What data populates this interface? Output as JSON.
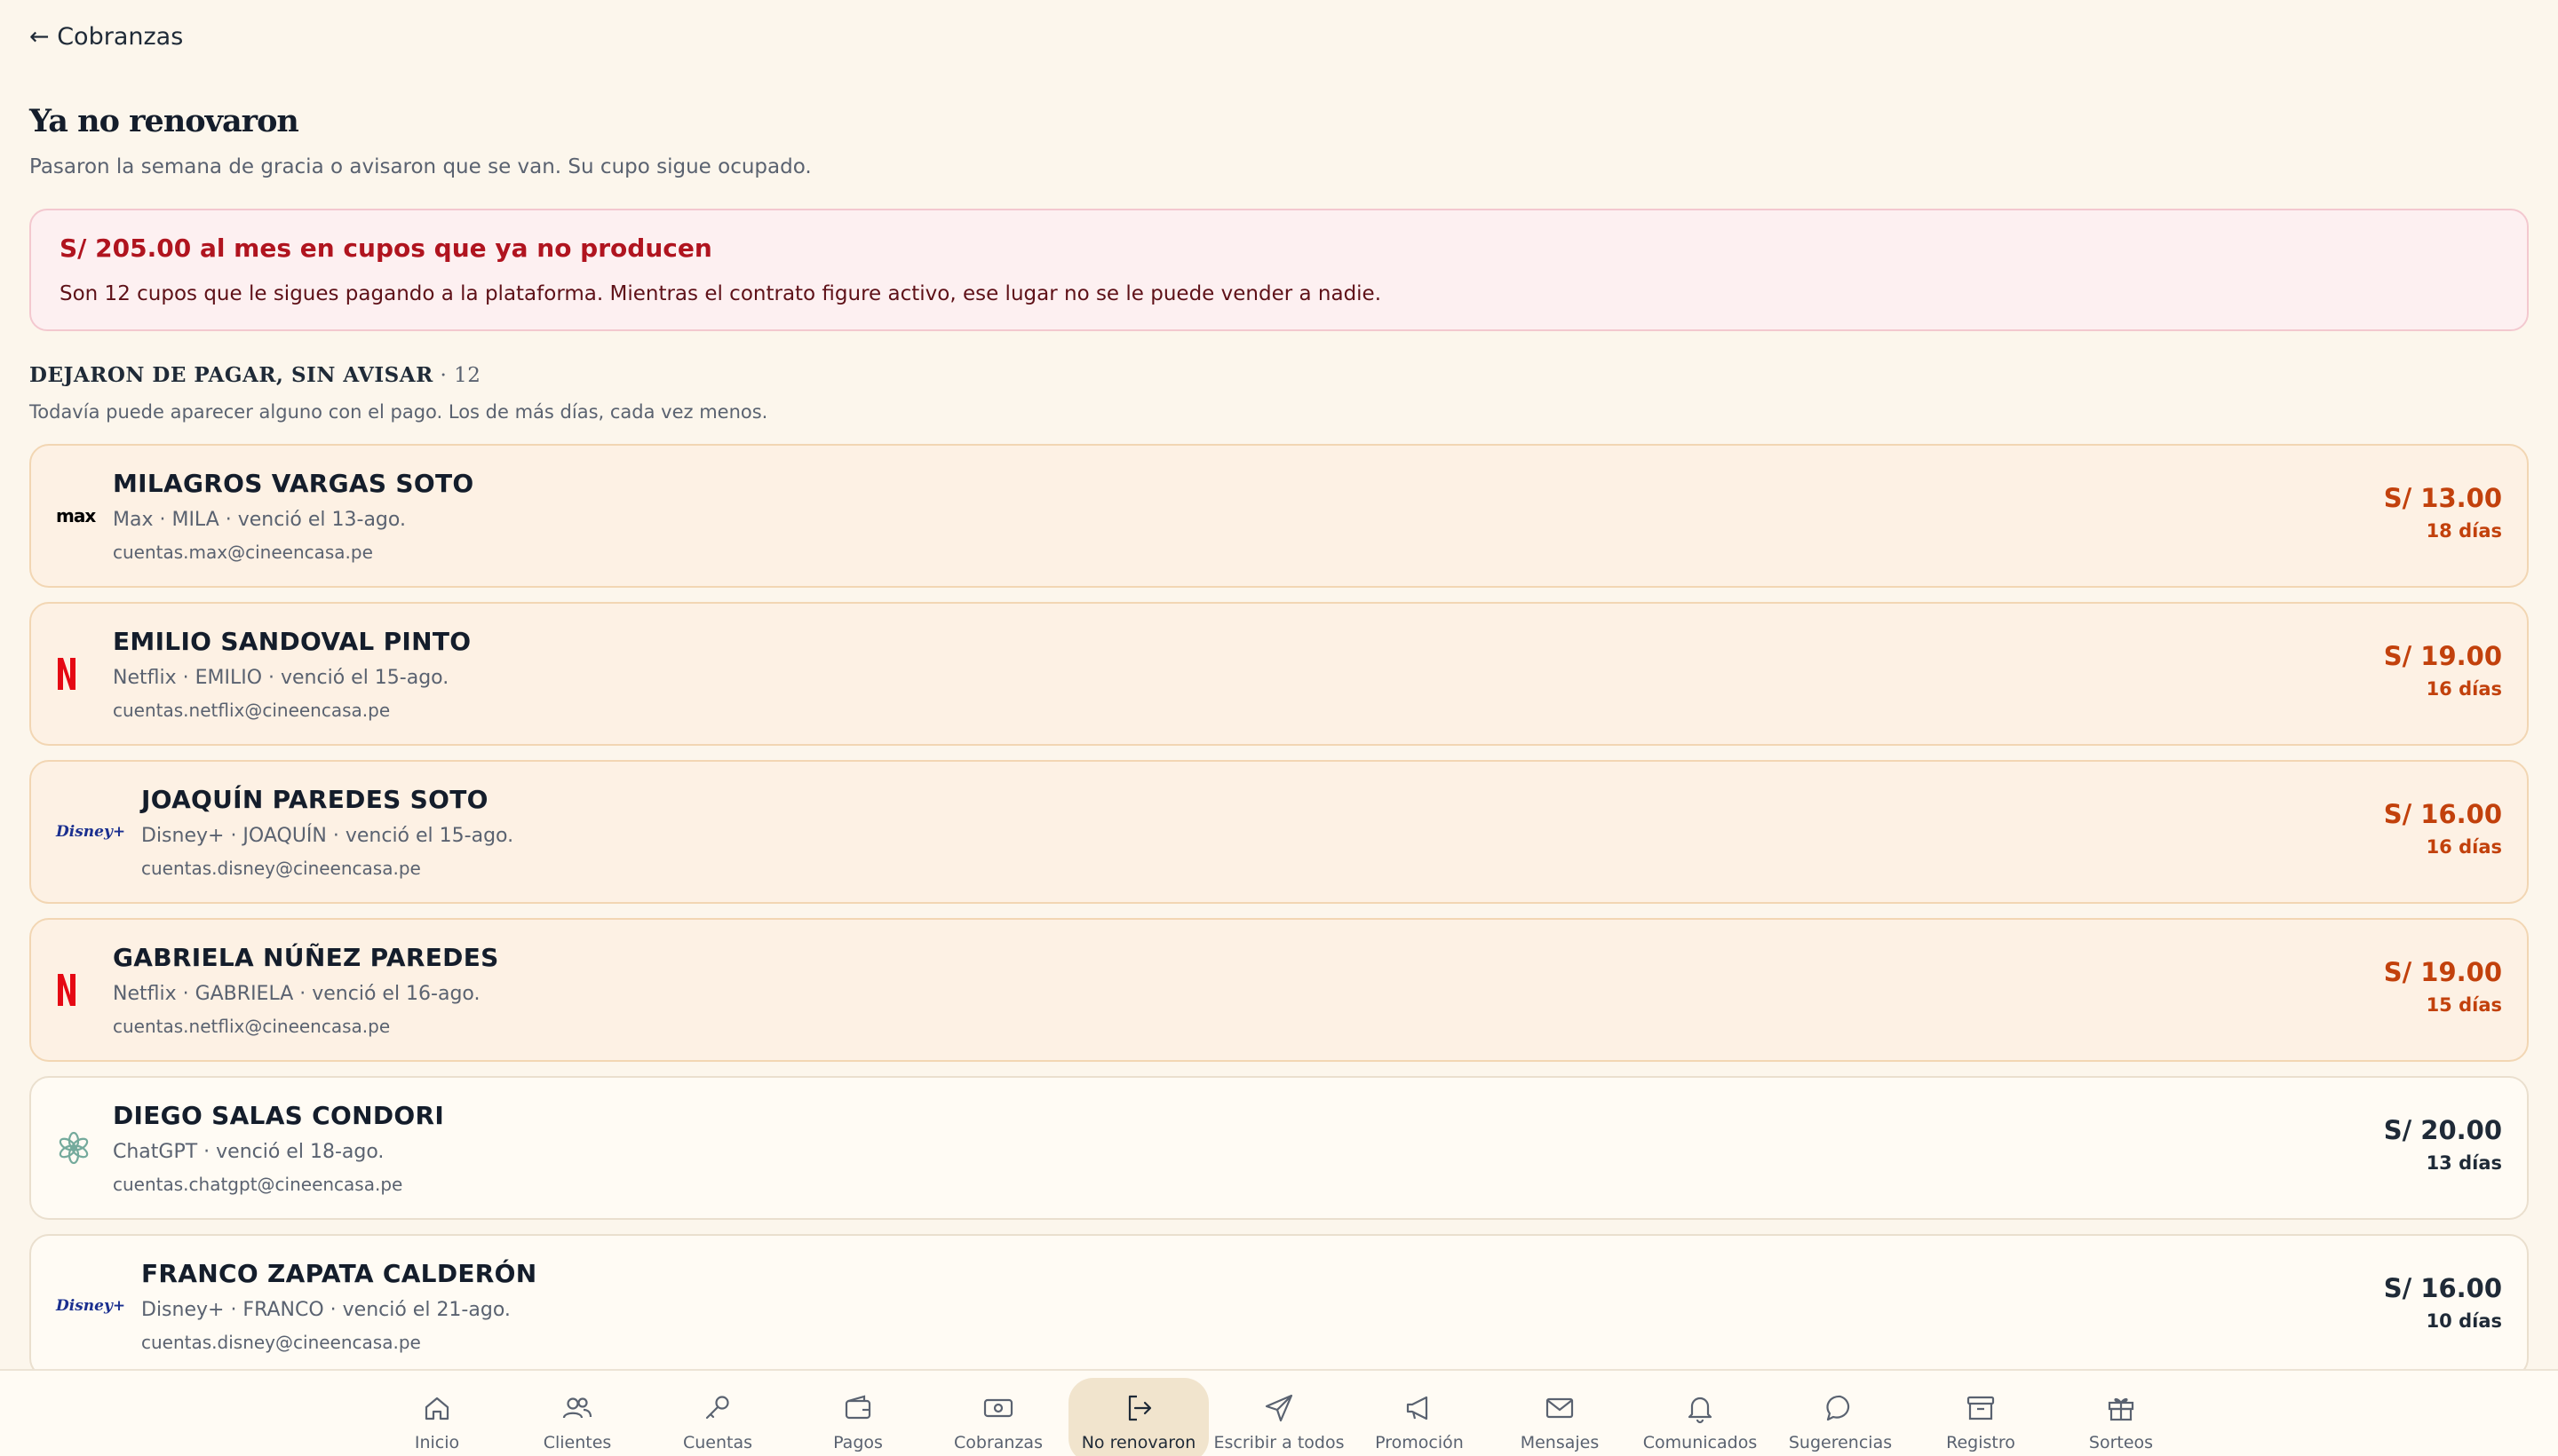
{
  "header": {
    "back_label": "← Cobranzas",
    "title": "Ya no renovaron",
    "subtitle": "Pasaron la semana de gracia o avisaron que se van. Su cupo sigue ocupado."
  },
  "alert": {
    "title": "S/ 205.00 al mes en cupos que ya no producen",
    "text": "Son 12 cupos que le sigues pagando a la plataforma. Mientras el contrato figure activo, ese lugar no se le puede vender a nadie."
  },
  "section": {
    "title": "DEJARON DE PAGAR, SIN AVISAR",
    "count": " · 12",
    "subtitle": "Todavía puede aparecer alguno con el pago. Los de más días, cada vez menos."
  },
  "colors": {
    "accent_overdue": "#c2410c",
    "alert_red": "#b0141f",
    "netflix_red": "#e50914",
    "disney_blue": "#1a2f8f",
    "chatgpt_teal": "#74aa9c"
  },
  "rows": [
    {
      "name": "MILAGROS VARGAS SOTO",
      "meta": "Max · MILA · venció el 13-ago.",
      "email": "cuentas.max@cineencasa.pe",
      "price": "S/ 13.00",
      "days": "18 días",
      "logo": "max",
      "logo_text": "max",
      "variant": "overdue"
    },
    {
      "name": "EMILIO SANDOVAL PINTO",
      "meta": "Netflix · EMILIO · venció el 15-ago.",
      "email": "cuentas.netflix@cineencasa.pe",
      "price": "S/ 19.00",
      "days": "16 días",
      "logo": "netflix",
      "logo_text": "",
      "variant": "overdue"
    },
    {
      "name": "JOAQUÍN PAREDES SOTO",
      "meta": "Disney+ · JOAQUÍN · venció el 15-ago.",
      "email": "cuentas.disney@cineencasa.pe",
      "price": "S/ 16.00",
      "days": "16 días",
      "logo": "disney",
      "logo_text": "Disney+",
      "variant": "overdue"
    },
    {
      "name": "GABRIELA NÚÑEZ PAREDES",
      "meta": "Netflix · GABRIELA · venció el 16-ago.",
      "email": "cuentas.netflix@cineencasa.pe",
      "price": "S/ 19.00",
      "days": "15 días",
      "logo": "netflix",
      "logo_text": "",
      "variant": "overdue"
    },
    {
      "name": "DIEGO SALAS CONDORI",
      "meta": "ChatGPT · venció el 18-ago.",
      "email": "cuentas.chatgpt@cineencasa.pe",
      "price": "S/ 20.00",
      "days": "13 días",
      "logo": "chatgpt",
      "logo_text": "",
      "variant": "neutral"
    },
    {
      "name": "FRANCO ZAPATA CALDERÓN",
      "meta": "Disney+ · FRANCO · venció el 21-ago.",
      "email": "cuentas.disney@cineencasa.pe",
      "price": "S/ 16.00",
      "days": "10 días",
      "logo": "disney",
      "logo_text": "Disney+",
      "variant": "neutral"
    }
  ],
  "nav": [
    {
      "label": "Inicio",
      "icon": "home-icon",
      "active": false
    },
    {
      "label": "Clientes",
      "icon": "users-icon",
      "active": false
    },
    {
      "label": "Cuentas",
      "icon": "key-icon",
      "active": false
    },
    {
      "label": "Pagos",
      "icon": "wallet-icon",
      "active": false
    },
    {
      "label": "Cobranzas",
      "icon": "banknote-icon",
      "active": false
    },
    {
      "label": "No renovaron",
      "icon": "logout-icon",
      "active": true
    },
    {
      "label": "Escribir a todos",
      "icon": "send-icon",
      "active": false
    },
    {
      "label": "Promoción",
      "icon": "megaphone-icon",
      "active": false
    },
    {
      "label": "Mensajes",
      "icon": "mail-icon",
      "active": false
    },
    {
      "label": "Comunicados",
      "icon": "bell-icon",
      "active": false
    },
    {
      "label": "Sugerencias",
      "icon": "chat-bubble-icon",
      "active": false
    },
    {
      "label": "Registro",
      "icon": "archive-icon",
      "active": false
    },
    {
      "label": "Sorteos",
      "icon": "gift-icon",
      "active": false
    }
  ]
}
